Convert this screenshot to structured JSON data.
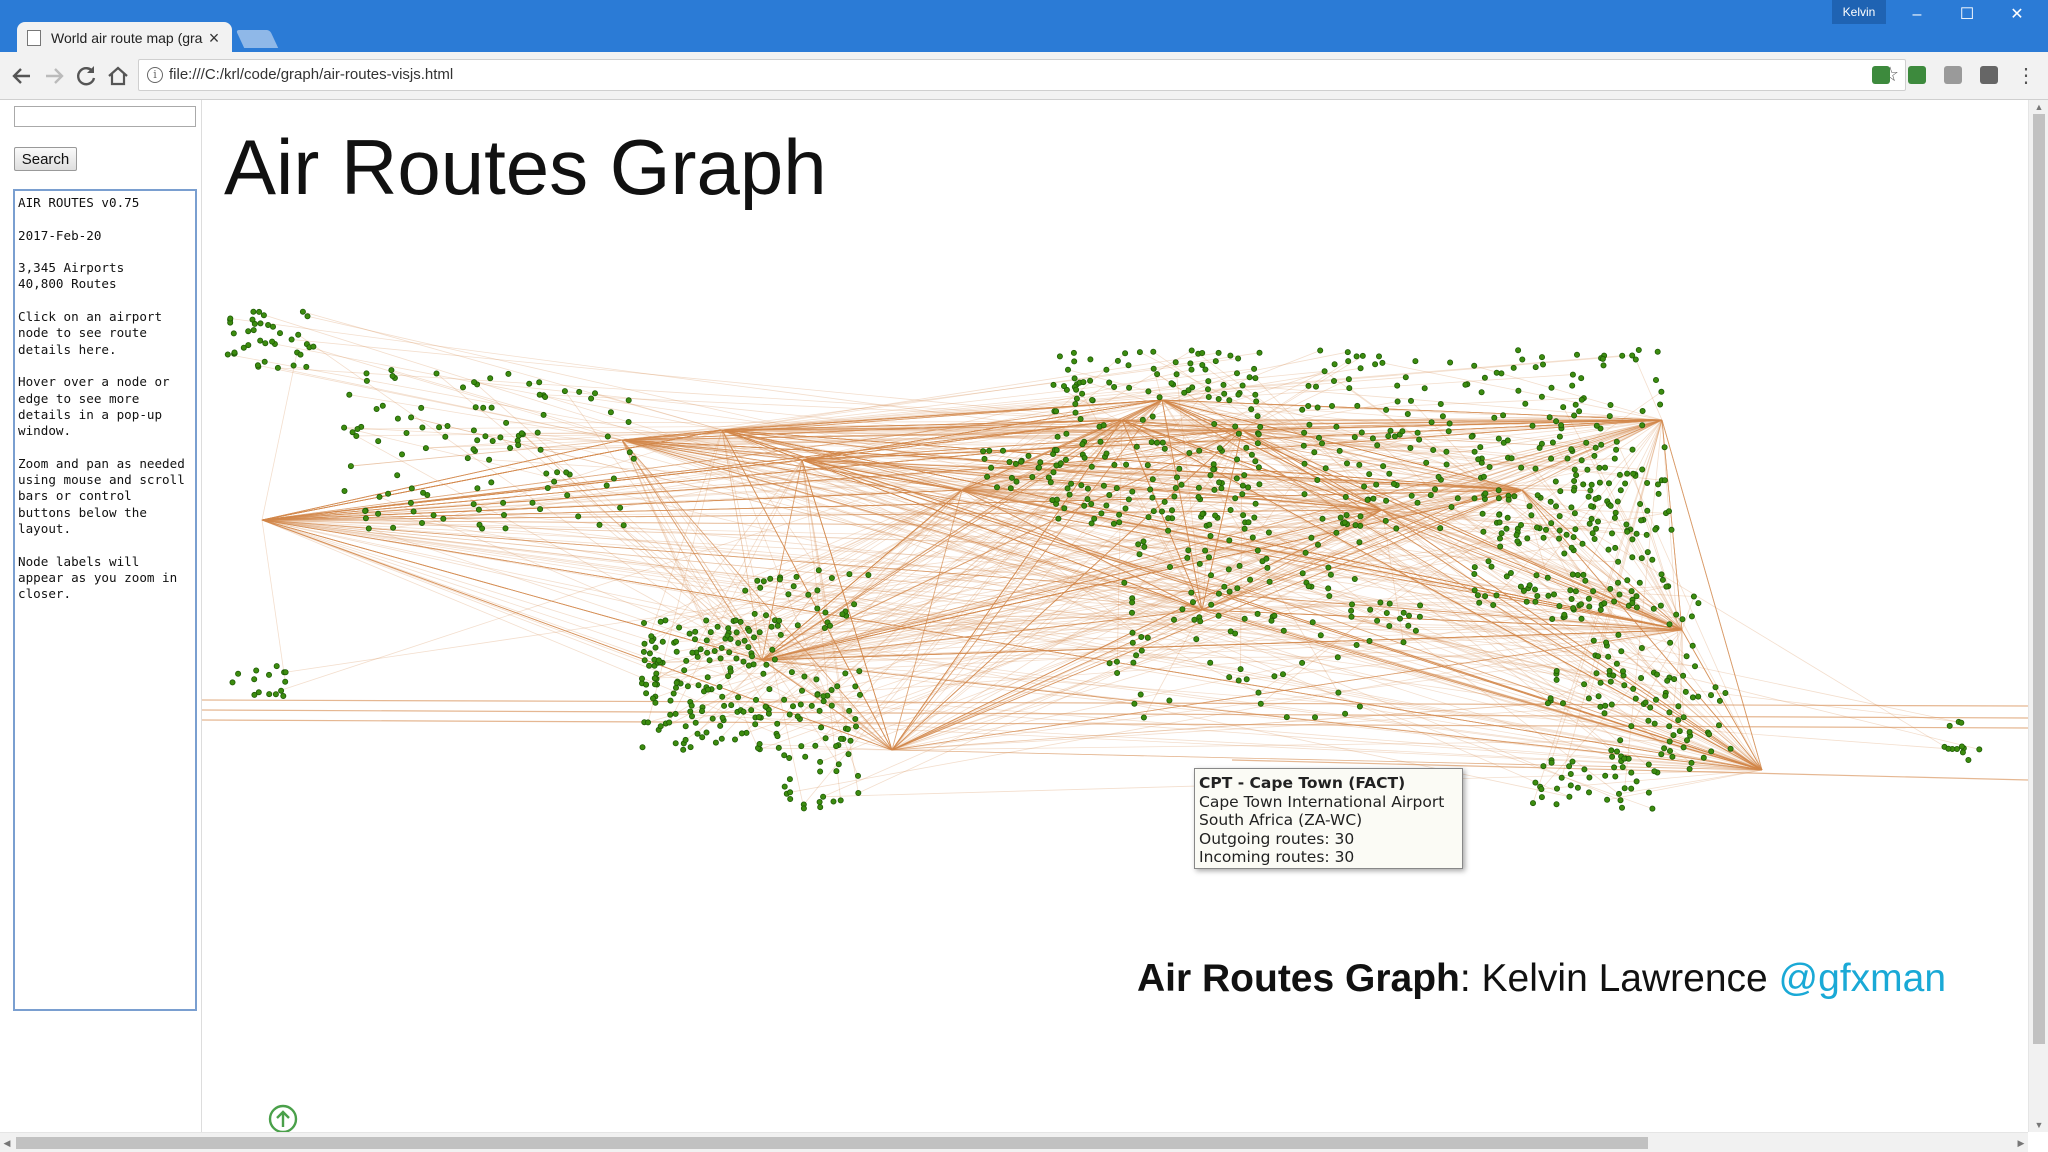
{
  "browser": {
    "tab_title": "World air route map (gra",
    "user_name": "Kelvin",
    "url": "file:///C:/krl/code/graph/air-routes-visjs.html",
    "window_controls": {
      "minimize": "–",
      "maximize": "☐",
      "close": "✕"
    }
  },
  "sidebar": {
    "search_value": "",
    "search_button": "Search",
    "info_text": "AIR ROUTES v0.75\n\n2017-Feb-20\n\n3,345 Airports\n40,800 Routes\n\nClick on an airport node to see route details here.\n\nHover over a node or edge to see more details in a pop-up window.\n\nZoom and pan as needed using mouse and scroll bars or control buttons below the layout.\n\nNode labels will appear as you zoom in closer."
  },
  "main": {
    "title": "Air Routes Graph",
    "tooltip": {
      "title": "CPT - Cape Town (FACT)",
      "airport": "Cape Town International Airport",
      "country": "South Africa (ZA-WC)",
      "outgoing": "Outgoing routes: 30",
      "incoming": "Incoming routes: 30"
    },
    "credit": {
      "bold": "Air Routes Graph",
      "separator": ": ",
      "author": "Kelvin Lawrence ",
      "handle": "@gfxman"
    }
  },
  "colors": {
    "edge": "#d4874a",
    "node": "#3c8c0f",
    "node_outline": "#1f5c06",
    "titlebar": "#2b7bd6",
    "handle": "#1aa9d6"
  },
  "icons": {
    "back": "arrow-left-icon",
    "forward": "arrow-right-icon",
    "reload": "reload-icon",
    "home": "home-icon",
    "info": "info-icon",
    "bookmark": "star-icon",
    "menu": "kebab-menu-icon",
    "zoom_up": "arrow-up-circle-icon"
  }
}
